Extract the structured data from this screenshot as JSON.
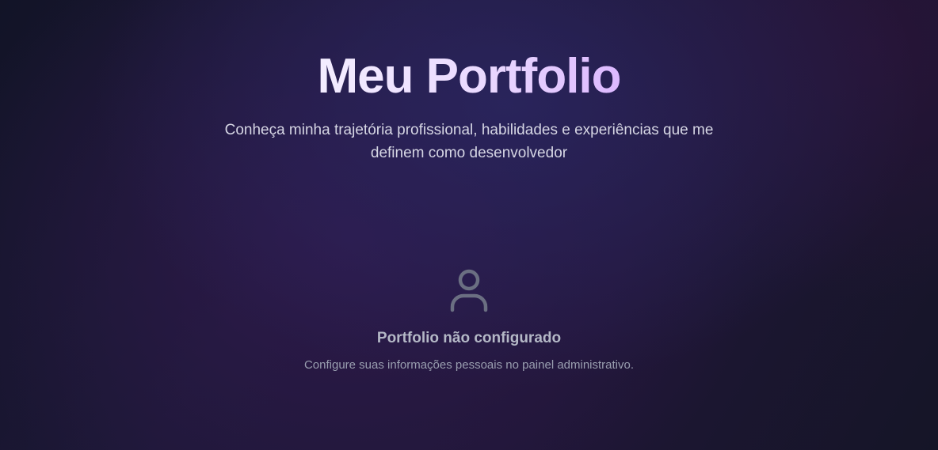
{
  "hero": {
    "title": "Meu Portfolio",
    "subtitle": "Conheça minha trajetória profissional, habilidades e experiências que me definem como desenvolvedor"
  },
  "empty_state": {
    "icon": "user-icon",
    "title": "Portfolio não configurado",
    "message": "Configure suas informações pessoais no painel administrativo."
  },
  "colors": {
    "background": "#1c1834",
    "title_gradient_start": "#f3edff",
    "title_gradient_end": "#dcb8ff",
    "icon": "#6b6f82"
  }
}
